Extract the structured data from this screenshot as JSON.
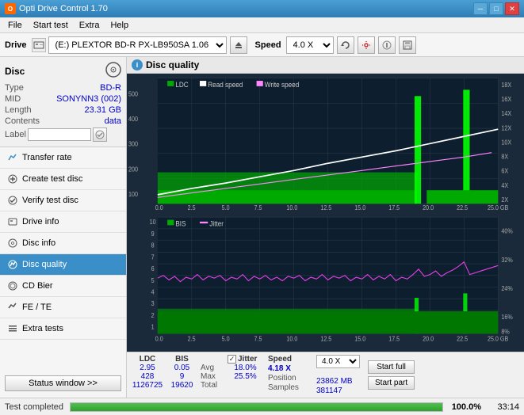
{
  "app": {
    "title": "Opti Drive Control 1.70",
    "icon": "O"
  },
  "titlebar": {
    "minimize": "─",
    "maximize": "□",
    "close": "✕"
  },
  "menu": {
    "items": [
      "File",
      "Start test",
      "Extra",
      "Help"
    ]
  },
  "toolbar": {
    "drive_label": "Drive",
    "drive_value": "(E:)  PLEXTOR BD-R  PX-LB950SA 1.06",
    "speed_label": "Speed",
    "speed_value": "4.0 X"
  },
  "disc": {
    "title": "Disc",
    "type_label": "Type",
    "type_value": "BD-R",
    "mid_label": "MID",
    "mid_value": "SONYNN3 (002)",
    "length_label": "Length",
    "length_value": "23.31 GB",
    "contents_label": "Contents",
    "contents_value": "data",
    "label_label": "Label",
    "label_value": ""
  },
  "nav": {
    "items": [
      {
        "id": "transfer-rate",
        "label": "Transfer rate",
        "active": false
      },
      {
        "id": "create-test-disc",
        "label": "Create test disc",
        "active": false
      },
      {
        "id": "verify-test-disc",
        "label": "Verify test disc",
        "active": false
      },
      {
        "id": "drive-info",
        "label": "Drive info",
        "active": false
      },
      {
        "id": "disc-info",
        "label": "Disc info",
        "active": false
      },
      {
        "id": "disc-quality",
        "label": "Disc quality",
        "active": true
      },
      {
        "id": "cd-bier",
        "label": "CD Bier",
        "active": false
      },
      {
        "id": "fe-te",
        "label": "FE / TE",
        "active": false
      },
      {
        "id": "extra-tests",
        "label": "Extra tests",
        "active": false
      }
    ]
  },
  "chart": {
    "title": "Disc quality",
    "legend": {
      "ldc": "LDC",
      "read_speed": "Read speed",
      "write_speed": "Write speed"
    },
    "legend2": {
      "bis": "BIS",
      "jitter": "Jitter"
    },
    "x_labels": [
      "0.0",
      "2.5",
      "5.0",
      "7.5",
      "10.0",
      "12.5",
      "15.0",
      "17.5",
      "20.0",
      "22.5",
      "25.0 GB"
    ],
    "y_left_top": [
      "500",
      "400",
      "300",
      "200",
      "100"
    ],
    "y_right_top": [
      "18X",
      "16X",
      "14X",
      "12X",
      "10X",
      "8X",
      "6X",
      "4X",
      "2X"
    ],
    "y_left_bottom": [
      "10",
      "9",
      "8",
      "7",
      "6",
      "5",
      "4",
      "3",
      "2",
      "1"
    ],
    "y_right_bottom": [
      "40%",
      "32%",
      "24%",
      "16%",
      "8%"
    ]
  },
  "stats": {
    "headers": [
      "LDC",
      "BIS",
      "",
      "Jitter",
      "Speed",
      ""
    ],
    "avg_label": "Avg",
    "avg_ldc": "2.95",
    "avg_bis": "0.05",
    "avg_jitter": "18.0%",
    "max_label": "Max",
    "max_ldc": "428",
    "max_bis": "9",
    "max_jitter": "25.5%",
    "total_label": "Total",
    "total_ldc": "1126725",
    "total_bis": "19620",
    "speed_label": "Speed",
    "speed_value": "4.18 X",
    "speed_select": "4.0 X",
    "position_label": "Position",
    "position_value": "23862 MB",
    "samples_label": "Samples",
    "samples_value": "381147",
    "start_full": "Start full",
    "start_part": "Start part",
    "jitter_checked": true
  },
  "statusbar": {
    "text": "Test completed",
    "progress": 100,
    "percent": "100.0%",
    "time": "33:14"
  },
  "status_window_btn": "Status window >>"
}
